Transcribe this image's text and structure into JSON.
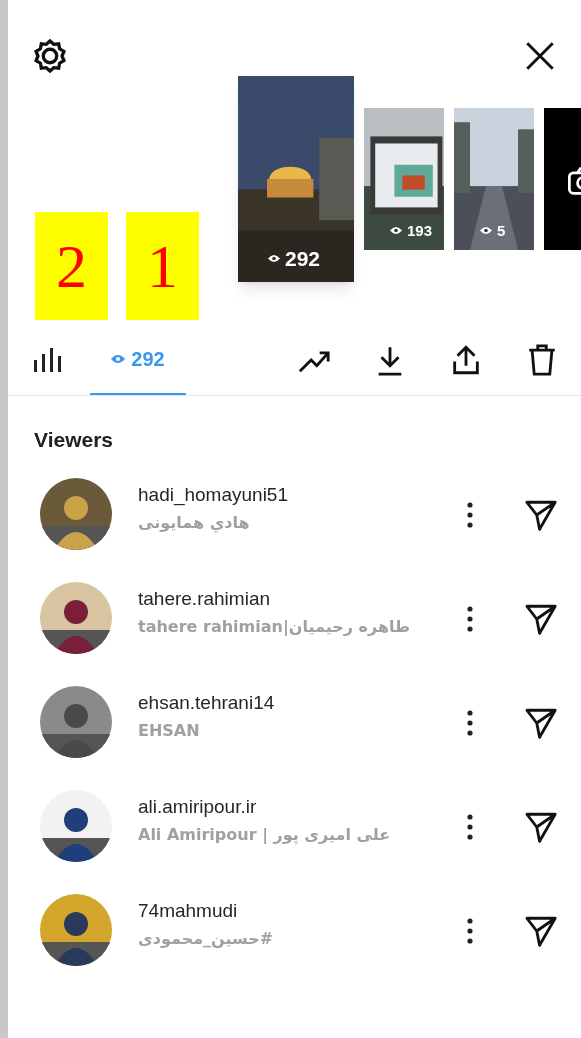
{
  "stories": [
    {
      "selected": true,
      "views": "292",
      "kind": "picture"
    },
    {
      "selected": false,
      "views": "193",
      "kind": "picture"
    },
    {
      "selected": false,
      "views": "5",
      "kind": "picture"
    },
    {
      "selected": false,
      "kind": "camera"
    }
  ],
  "annotations": [
    "2",
    "1"
  ],
  "tabs": [
    {
      "kind": "insights",
      "selected": false
    },
    {
      "kind": "viewers",
      "label": "292",
      "selected": true
    }
  ],
  "actions": [
    {
      "kind": "trend"
    },
    {
      "kind": "download"
    },
    {
      "kind": "share"
    },
    {
      "kind": "delete"
    }
  ],
  "viewers_heading": "Viewers",
  "viewers": [
    {
      "username": "hadi_homayuni51",
      "name": "هادي همايونی"
    },
    {
      "username": "tahere.rahimian",
      "name": "tahere rahimian|طاهره رحیمیان"
    },
    {
      "username": "ehsan.tehrani14",
      "name": "EHSAN"
    },
    {
      "username": "ali.amiripour.ir",
      "name": "Ali Amiripour | علی امیری پور"
    },
    {
      "username": "74mahmudi",
      "name": "#حسین_محمودی"
    }
  ]
}
